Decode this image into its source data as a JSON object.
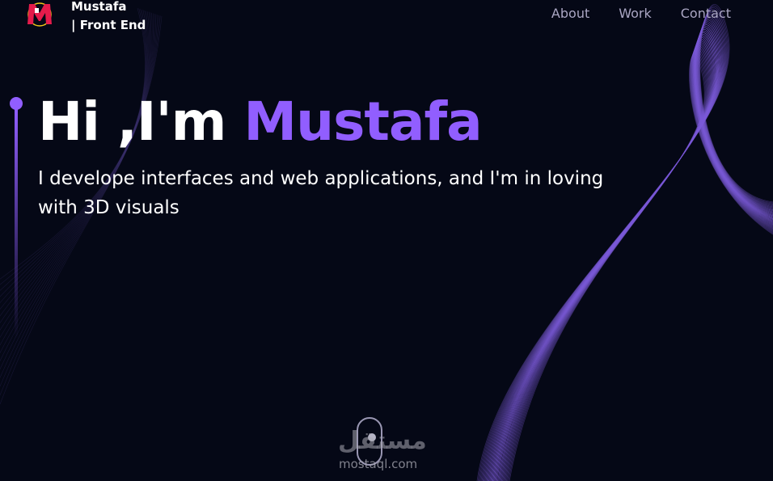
{
  "header": {
    "brand_line1": "Mustafa",
    "brand_line2": "| Front End",
    "nav": [
      {
        "label": "About"
      },
      {
        "label": "Work"
      },
      {
        "label": "Contact"
      }
    ]
  },
  "hero": {
    "title_prefix": "Hi ,I'm ",
    "title_name": "Mustafa",
    "subtitle": "I develope interfaces and web applications, and I'm in loving with 3D visuals"
  },
  "watermark": {
    "arabic": "مستقل",
    "domain": "mostaql.com"
  },
  "colors": {
    "background": "#050816",
    "accent": "#915eff",
    "nav_text": "#aaa6c3",
    "text": "#ffffff",
    "logo_red": "#e51b4b"
  },
  "icons": {
    "logo": "m-logo-icon",
    "scroll": "mouse-scroll-icon"
  }
}
